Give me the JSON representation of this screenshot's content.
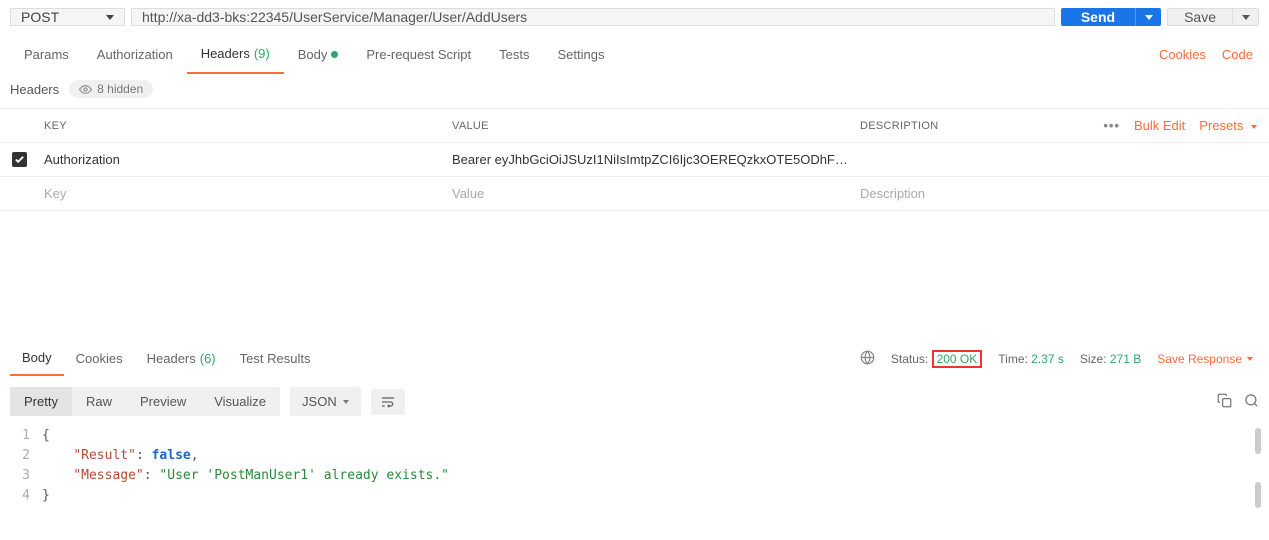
{
  "request": {
    "method": "POST",
    "url": "http://xa-dd3-bks:22345/UserService/Manager/User/AddUsers",
    "send_label": "Send",
    "save_label": "Save"
  },
  "request_tabs": {
    "params": "Params",
    "authorization": "Authorization",
    "headers": "Headers",
    "headers_count": "(9)",
    "body": "Body",
    "pre_request": "Pre-request Script",
    "tests": "Tests",
    "settings": "Settings",
    "cookies_link": "Cookies",
    "code_link": "Code"
  },
  "headers_section": {
    "title": "Headers",
    "hidden_label": "8 hidden",
    "col_key": "KEY",
    "col_value": "VALUE",
    "col_desc": "DESCRIPTION",
    "bulk_edit": "Bulk Edit",
    "presets": "Presets",
    "rows": [
      {
        "key": "Authorization",
        "value": "Bearer eyJhbGciOiJSUzI1NiIsImtpZCI6Ijc3OEREQzkxOTE5ODhFRE…",
        "desc": ""
      }
    ],
    "placeholder": {
      "key": "Key",
      "value": "Value",
      "desc": "Description"
    }
  },
  "response_tabs": {
    "body": "Body",
    "cookies": "Cookies",
    "headers": "Headers",
    "headers_count": "(6)",
    "test_results": "Test Results"
  },
  "response_meta": {
    "status_label": "Status:",
    "status_value": "200 OK",
    "time_label": "Time:",
    "time_value": "2.37 s",
    "size_label": "Size:",
    "size_value": "271 B",
    "save_response": "Save Response"
  },
  "body_toolbar": {
    "pretty": "Pretty",
    "raw": "Raw",
    "preview": "Preview",
    "visualize": "Visualize",
    "json": "JSON"
  },
  "response_body": {
    "lines": [
      {
        "n": "1",
        "html": "<span class='tok-brace'>{</span>"
      },
      {
        "n": "2",
        "html": "    <span class='tok-key'>\"Result\"</span><span class='tok-punc'>: </span><span class='tok-bool'>false</span><span class='tok-punc'>,</span>"
      },
      {
        "n": "3",
        "html": "    <span class='tok-key'>\"Message\"</span><span class='tok-punc'>: </span><span class='tok-str'>\"User 'PostManUser1' already exists.\"</span>"
      },
      {
        "n": "4",
        "html": "<span class='tok-brace'>}</span>"
      }
    ]
  },
  "chart_data": {
    "type": "table",
    "title": "Response JSON",
    "data": {
      "Result": false,
      "Message": "User 'PostManUser1' already exists."
    }
  }
}
